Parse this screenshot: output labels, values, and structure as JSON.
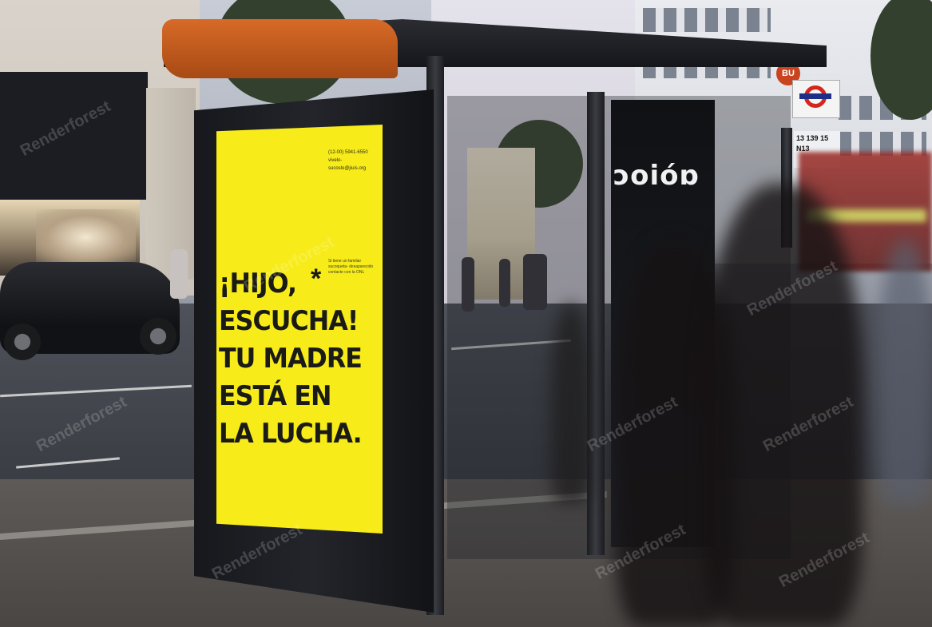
{
  "poster": {
    "headline_lines": [
      "¡HIJO,",
      "ESCUCHA!",
      "TU MADRE",
      "ESTÁ EN",
      "LA LUCHA."
    ],
    "asterisk": "*",
    "contact_phone": "(12-00) 5941-6550",
    "contact_email": "vivelo-sucoslo@jiuis.org",
    "note": "Si tiene un familiar sucoqueta- desaparecido contacte con la ONL",
    "color": "#f7ec1a"
  },
  "side_panel": {
    "logo_text": "ɔoióɒ"
  },
  "signs": {
    "bus_label": "BU",
    "stop_routes": [
      "13",
      "139",
      "15"
    ],
    "stop_night": "N13"
  },
  "watermark": {
    "text": "Renderforest"
  },
  "colors": {
    "shelter_roof_edge": "#d76a27",
    "poster_text": "#1a1a16",
    "bus": "#9a2a25"
  }
}
